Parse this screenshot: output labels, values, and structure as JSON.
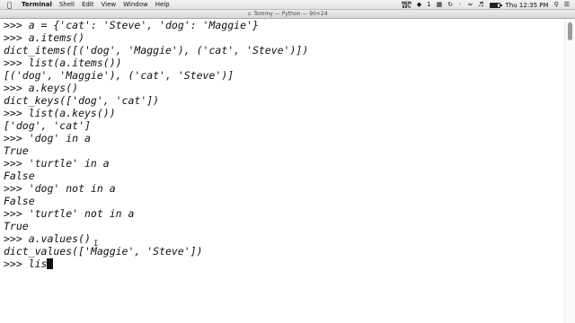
{
  "menubar": {
    "app_name": "Terminal",
    "items": [
      "Shell",
      "Edit",
      "View",
      "Window",
      "Help"
    ],
    "status": {
      "mem_label": "MEM",
      "mem_value": "88%",
      "battery_level": 0.85,
      "clock": "Thu 12:35 PM"
    }
  },
  "window": {
    "title": "Tommy — Python — 90×24"
  },
  "terminal": {
    "lines": [
      ">>> a = {'cat': 'Steve', 'dog': 'Maggie'}",
      ">>> a.items()",
      "dict_items([('dog', 'Maggie'), ('cat', 'Steve')])",
      ">>> list(a.items())",
      "[('dog', 'Maggie'), ('cat', 'Steve')]",
      ">>> a.keys()",
      "dict_keys(['dog', 'cat'])",
      ">>> list(a.keys())",
      "['dog', 'cat']",
      ">>> 'dog' in a",
      "True",
      ">>> 'turtle' in a",
      "False",
      ">>> 'dog' not in a",
      "False",
      ">>> 'turtle' not in a",
      "True",
      ">>> a.values()",
      "dict_values(['Maggie', 'Steve'])",
      ">>> lis"
    ]
  },
  "scrollbar": {
    "position": 0.0,
    "visible_fraction": 0.06
  },
  "colors": {
    "text": "#111111",
    "background": "#ffffff",
    "scroll_thumb": "#9b9b9b"
  }
}
